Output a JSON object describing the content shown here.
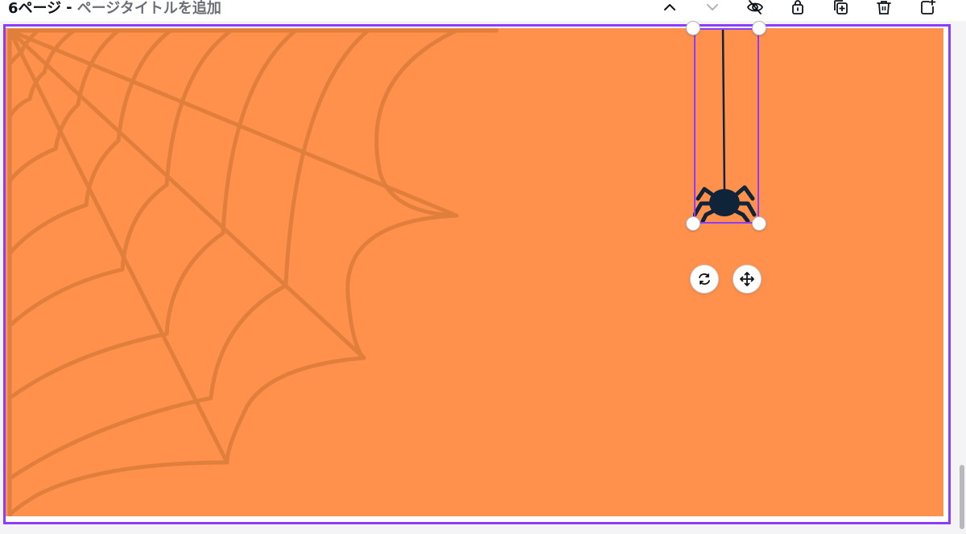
{
  "page_header": {
    "page_number": "6ページ",
    "separator": "-",
    "title_placeholder": "ページタイトルを追加"
  },
  "toolbar": {
    "buttons": [
      {
        "name": "move-page-up",
        "icon": "chevron-up-icon"
      },
      {
        "name": "move-page-down",
        "icon": "chevron-down-icon"
      },
      {
        "name": "hide-page",
        "icon": "eye-slash-icon"
      },
      {
        "name": "lock-page",
        "icon": "lock-icon"
      },
      {
        "name": "duplicate-page",
        "icon": "duplicate-icon"
      },
      {
        "name": "delete-page",
        "icon": "trash-icon"
      },
      {
        "name": "add-page",
        "icon": "add-page-icon"
      }
    ]
  },
  "canvas": {
    "background_color": "#ff914d",
    "web_color": "#e07f3c",
    "selection_color": "#8b3dff",
    "elements": [
      {
        "name": "spider-web",
        "icon": "spider-web-graphic"
      },
      {
        "name": "hanging-spider",
        "icon": "spider-graphic",
        "color": "#0f2438"
      }
    ]
  },
  "selection_controls": [
    {
      "name": "rotate-button",
      "icon": "rotate-icon"
    },
    {
      "name": "move-button",
      "icon": "move-arrows-icon"
    }
  ]
}
